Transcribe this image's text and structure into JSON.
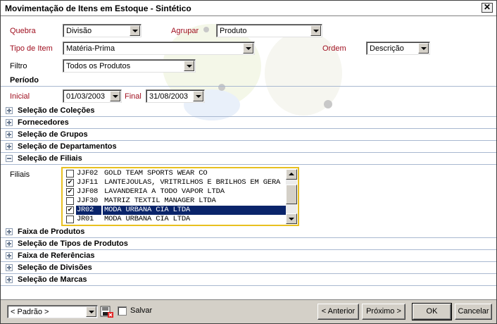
{
  "window": {
    "title": "Movimentação de Itens em Estoque - Sintético",
    "close_glyph": "✕"
  },
  "filters": {
    "quebra": {
      "label": "Quebra",
      "value": "Divisão"
    },
    "agrupar": {
      "label": "Agrupar",
      "value": "Produto"
    },
    "tipo_item": {
      "label": "Tipo de Item",
      "value": "Matéria-Prima"
    },
    "ordem": {
      "label": "Ordem",
      "value": "Descrição"
    },
    "filtro": {
      "label": "Filtro",
      "value": "Todos os Produtos"
    }
  },
  "periodo": {
    "heading": "Período",
    "inicial_label": "Inicial",
    "inicial_value": "01/03/2003",
    "final_label": "Final",
    "final_value": "31/08/2003"
  },
  "sections_top": [
    {
      "label": "Seleção de Coleções",
      "expanded": false
    },
    {
      "label": "Fornecedores",
      "expanded": false
    },
    {
      "label": "Seleção de Grupos",
      "expanded": false
    },
    {
      "label": "Seleção de Departamentos",
      "expanded": false
    },
    {
      "label": "Seleção de Filiais",
      "expanded": true
    }
  ],
  "filiais": {
    "label": "Filiais",
    "items": [
      {
        "code": "JJF02",
        "name": "GOLD TEAM SPORTS WEAR CO",
        "checked": false,
        "selected": false
      },
      {
        "code": "JJF11",
        "name": "LANTEJOULAS, VRITRILHOS E BRILHOS EM GERA",
        "checked": true,
        "selected": false
      },
      {
        "code": "JJF08",
        "name": "LAVANDERIA A TODO VAPOR LTDA",
        "checked": true,
        "selected": false
      },
      {
        "code": "JJF30",
        "name": "MATRIZ TEXTIL MANAGER LTDA",
        "checked": false,
        "selected": false
      },
      {
        "code": "JR02",
        "name": "MODA URBANA CIA LTDA",
        "checked": true,
        "selected": true
      },
      {
        "code": "JR01",
        "name": "MODA URBANA CIA LTDA",
        "checked": false,
        "selected": false
      }
    ]
  },
  "sections_bottom": [
    {
      "label": "Faixa de Produtos"
    },
    {
      "label": "Seleção de Tipos de Produtos"
    },
    {
      "label": "Faixa de Referências"
    },
    {
      "label": "Seleção de Divisões"
    },
    {
      "label": "Seleção de Marcas"
    }
  ],
  "footer": {
    "preset_value": "< Padrão >",
    "salvar_label": "Salvar",
    "anterior_label": "< Anterior",
    "proximo_label": "Próximo >",
    "ok_label": "OK",
    "cancelar_label": "Cancelar"
  },
  "colors": {
    "accent_red": "#a01020",
    "selection_blue": "#0a246a",
    "focus_border": "#e8c020",
    "section_line": "#a8b8d0"
  }
}
